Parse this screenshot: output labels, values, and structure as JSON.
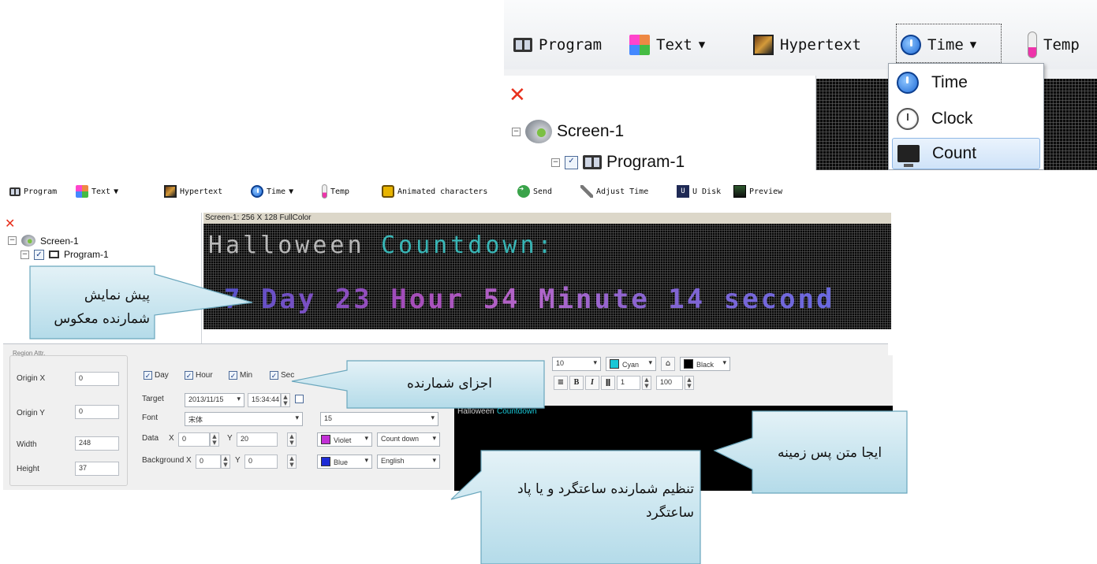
{
  "zoom_inset": {
    "toolbar": [
      {
        "label": "Program",
        "icon": "screen-icon"
      },
      {
        "label": "Text",
        "icon": "text-tiles-icon",
        "dropdown": true
      },
      {
        "label": "Hypertext",
        "icon": "picture-icon"
      },
      {
        "label": "Time",
        "icon": "clock-icon",
        "dropdown": true
      },
      {
        "label": "Temp",
        "icon": "thermometer-icon"
      }
    ],
    "time_menu": [
      {
        "label": "Time",
        "icon": "clock-icon"
      },
      {
        "label": "Clock",
        "icon": "analog-clock-icon"
      },
      {
        "label": "Count",
        "icon": "monitor-icon",
        "selected": true
      }
    ],
    "tree": {
      "screen": "Screen-1",
      "program": "Program-1"
    }
  },
  "toolbar": [
    {
      "label": "Program",
      "icon": "screen-icon"
    },
    {
      "label": "Text",
      "icon": "text-tiles-icon",
      "dropdown": true
    },
    {
      "label": "Hypertext",
      "icon": "picture-icon"
    },
    {
      "label": "Time",
      "icon": "clock-icon",
      "dropdown": true
    },
    {
      "label": "Temp",
      "icon": "thermometer-icon"
    },
    {
      "label": "Animated characters",
      "icon": "animated-characters-icon"
    },
    {
      "label": "Send",
      "icon": "send-icon"
    },
    {
      "label": "Adjust Time",
      "icon": "tools-icon"
    },
    {
      "label": "U Disk",
      "icon": "u-disk-icon"
    },
    {
      "label": "Preview",
      "icon": "preview-icon"
    }
  ],
  "tree": {
    "screen": "Screen-1",
    "program": "Program-1"
  },
  "screen_header": "Screen-1: 256 X 128 FullColor",
  "led": {
    "title_part1": "Halloween",
    "title_part2": "Countdown:",
    "countdown": "7 Day 23 Hour 54 Minute 14 second"
  },
  "region": {
    "title": "Region Attr.",
    "fields": [
      {
        "label": "Origin X",
        "value": "0"
      },
      {
        "label": "Origin Y",
        "value": "0"
      },
      {
        "label": "Width",
        "value": "248"
      },
      {
        "label": "Height",
        "value": "37"
      }
    ]
  },
  "counter": {
    "checks": [
      "Day",
      "Hour",
      "Min",
      "Sec"
    ],
    "target_label": "Target",
    "target_date": "2013/11/15",
    "target_time": "15:34:44",
    "font_label": "Font",
    "font_value": "宋体",
    "font_size": "15",
    "data_label": "Data",
    "data_x": "0",
    "data_y": "20",
    "bg_label": "Background",
    "bg_x": "0",
    "bg_y": "0",
    "data_color": "Violet",
    "bg_color": "Blue",
    "mode": "Count down",
    "language": "English"
  },
  "editor": {
    "font_size": "10",
    "fore_color": "Cyan",
    "back_color": "Black",
    "spacing": "1",
    "scale": "100",
    "text_a": "Halloween",
    "text_b": "Countdown"
  },
  "callouts": {
    "preview": "پیش نمایش شمارنده معکوس",
    "components": "اجزای شمارنده",
    "background_text": "ایجا متن پس زمینه",
    "settings": "تنظیم شمارنده ساعتگرد و یا پاد ساعتگرد"
  },
  "colors": {
    "cyan": "#38b6b6",
    "violet": "#c22fd6",
    "blue": "#1d2bd6",
    "led_bg": "#070707"
  }
}
